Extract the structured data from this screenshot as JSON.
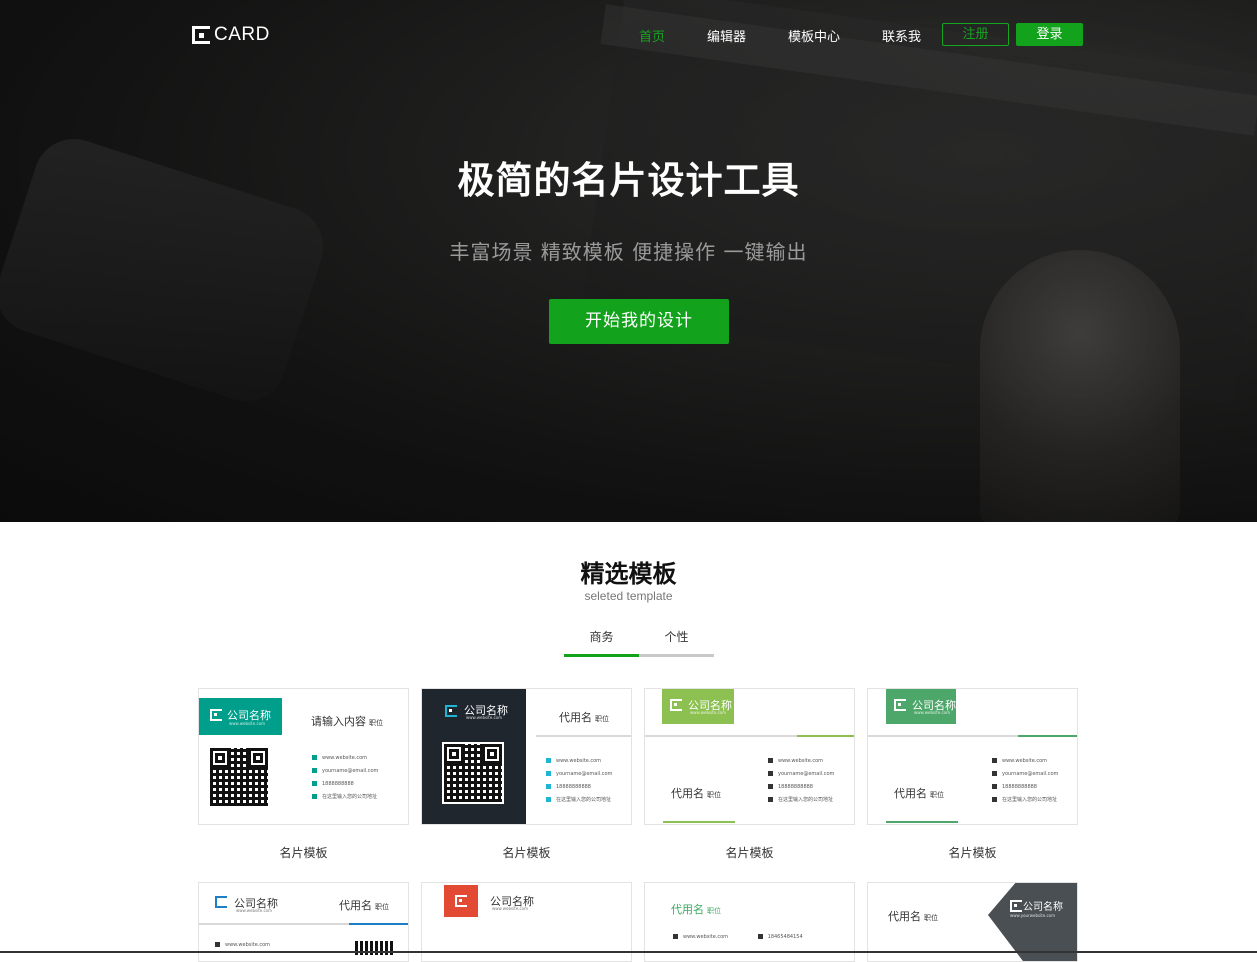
{
  "header": {
    "logo_text": "CARD",
    "nav": [
      "首页",
      "编辑器",
      "模板中心",
      "联系我"
    ],
    "register_label": "注册",
    "login_label": "登录"
  },
  "hero": {
    "title": "极简的名片设计工具",
    "subtitle": "丰富场景 精致模板 便捷操作 一键输出",
    "cta_label": "开始我的设计"
  },
  "section": {
    "title": "精选模板",
    "subtitle": "seleted template",
    "tabs": [
      "商务",
      "个性"
    ],
    "active_tab": 0
  },
  "colors": {
    "accent": "#13a21c",
    "teal": "#009f8b",
    "dark": "#1f262d",
    "lime": "#8cc152",
    "green": "#4ea76a",
    "blue": "#1f7ec8",
    "red": "#e24a33",
    "slate": "#4a4f54"
  },
  "cards": [
    {
      "label": "名片模板",
      "company": "公司名称",
      "website_small": "www.website.com",
      "name": "请输入内容",
      "title": "职位",
      "lines": [
        "www.website.com",
        "yourname@email.com",
        "1888888888",
        "在这里输入您的公司地址"
      ]
    },
    {
      "label": "名片模板",
      "company": "公司名称",
      "website_small": "www.website.com",
      "name": "代用名",
      "title": "职位",
      "lines": [
        "www.website.com",
        "yourname@email.com",
        "18888888888",
        "在这里输入您的公司地址"
      ]
    },
    {
      "label": "名片模板",
      "company": "公司名称",
      "website_small": "www.website.com",
      "name": "代用名",
      "title": "职位",
      "lines": [
        "www.website.com",
        "yourname@email.com",
        "18888888888",
        "在这里输入您的公司地址"
      ]
    },
    {
      "label": "名片模板",
      "company": "公司名称",
      "website_small": "www.website.com",
      "name": "代用名",
      "title": "职位",
      "lines": [
        "www.website.com",
        "yourname@email.com",
        "18888888888",
        "在这里输入您的公司地址"
      ]
    },
    {
      "company": "公司名称",
      "website_small": "www.website.com",
      "name": "代用名",
      "title": "职位",
      "lines": [
        "www.website.com"
      ]
    },
    {
      "company": "公司名称",
      "website_small": "www.website.com"
    },
    {
      "name": "代用名",
      "title": "职位",
      "lines": [
        "www.website.com",
        "18465484154"
      ]
    },
    {
      "company": "公司名称",
      "website_small": "www.yourwebsite.com",
      "name": "代用名",
      "title": "职位"
    }
  ]
}
